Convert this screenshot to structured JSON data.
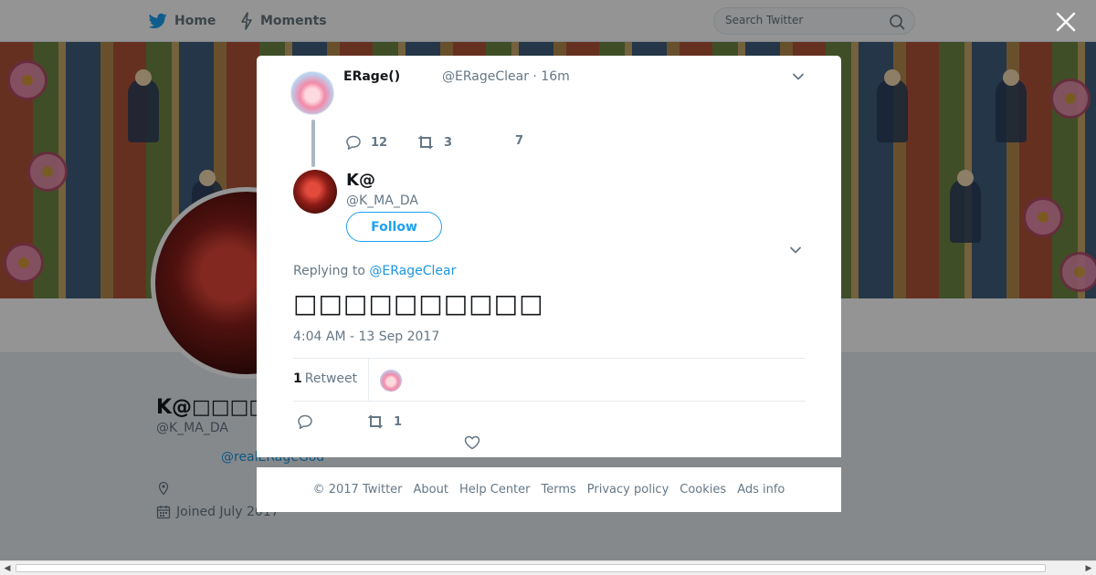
{
  "topbar": {
    "home_label": "Home",
    "moments_label": "Moments",
    "search_placeholder": "Search Twitter"
  },
  "profile": {
    "name": "K@□□□□□",
    "handle": "@K_MA_DA",
    "link": "@realERageGod",
    "joined": "Joined July 2017"
  },
  "modal": {
    "parent": {
      "name": "ERage()",
      "handle_time": "@ERageClear · 16m",
      "replies": "12",
      "retweets": "3",
      "likes": "7"
    },
    "author": {
      "name": "K@",
      "handle": "@K_MA_DA",
      "follow_label": "Follow"
    },
    "replying_prefix": "Replying to",
    "replying_handle": "@ERageClear",
    "text": "□□□□□□□□□□",
    "timestamp": "4:04 AM - 13 Sep 2017",
    "stats": {
      "retweet_count": "1",
      "retweet_label": "Retweet"
    },
    "actions": {
      "retweet_count": "1"
    }
  },
  "footer": {
    "copyright": "© 2017 Twitter",
    "links": [
      "About",
      "Help Center",
      "Terms",
      "Privacy policy",
      "Cookies",
      "Ads info"
    ]
  },
  "colors": {
    "accent": "#1da1f2",
    "link": "#1b95e0",
    "muted": "#657786"
  }
}
